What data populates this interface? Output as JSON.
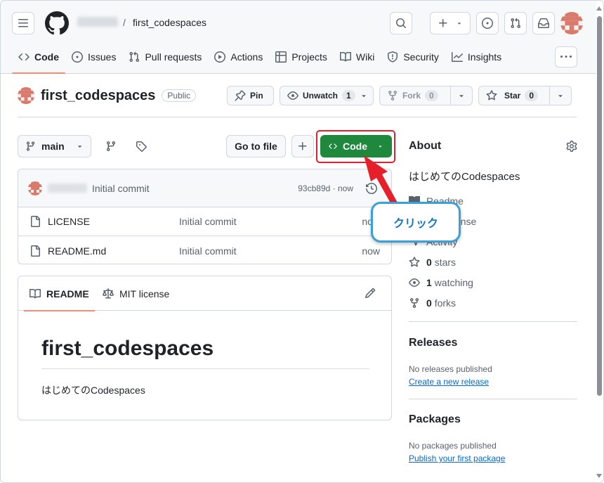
{
  "header": {
    "repo_name": "first_codespaces",
    "breadcrumb_separator": "/"
  },
  "tabs": [
    {
      "label": "Code",
      "icon": "code-icon",
      "active": true
    },
    {
      "label": "Issues",
      "icon": "issue-icon"
    },
    {
      "label": "Pull requests",
      "icon": "pull-request-icon"
    },
    {
      "label": "Actions",
      "icon": "play-icon"
    },
    {
      "label": "Projects",
      "icon": "table-icon"
    },
    {
      "label": "Wiki",
      "icon": "book-icon"
    },
    {
      "label": "Security",
      "icon": "shield-icon"
    },
    {
      "label": "Insights",
      "icon": "graph-icon"
    }
  ],
  "repo": {
    "name": "first_codespaces",
    "visibility": "Public",
    "pin_label": "Pin",
    "unwatch_label": "Unwatch",
    "watch_count": "1",
    "fork_label": "Fork",
    "fork_count": "0",
    "star_label": "Star",
    "star_count": "0"
  },
  "toolbar": {
    "branch": "main",
    "goto_file": "Go to file",
    "code_button": "Code"
  },
  "commit": {
    "message": "Initial commit",
    "hash": "93cb89d",
    "separator": "·",
    "time": "now"
  },
  "files": [
    {
      "name": "LICENSE",
      "message": "Initial commit",
      "time": "now"
    },
    {
      "name": "README.md",
      "message": "Initial commit",
      "time": "now"
    }
  ],
  "readme": {
    "tab_readme": "README",
    "tab_license": "MIT license",
    "heading": "first_codespaces",
    "body": "はじめてのCodespaces"
  },
  "about": {
    "title": "About",
    "description": "はじめてのCodespaces",
    "readme_link": "Readme",
    "license_link": "MIT license",
    "activity_link": "Activity",
    "stars_count": "0",
    "stars_label": "stars",
    "watching_count": "1",
    "watching_label": "watching",
    "forks_count": "0",
    "forks_label": "forks"
  },
  "releases": {
    "title": "Releases",
    "empty": "No releases published",
    "link": "Create a new release"
  },
  "packages": {
    "title": "Packages",
    "empty": "No packages published",
    "link": "Publish your first package"
  },
  "annotation": {
    "callout_text": "クリック",
    "arrow_color": "#e5202a",
    "highlight_color": "#e5202a",
    "callout_border": "#3aa0d8"
  },
  "colors": {
    "primary_button": "#1f883d",
    "active_tab_underline": "#fd8c73",
    "link": "#0969da"
  }
}
